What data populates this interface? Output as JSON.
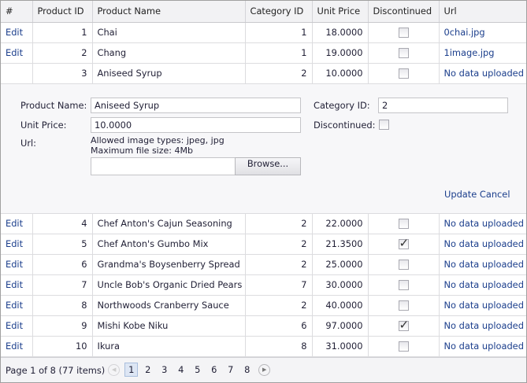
{
  "columns": [
    "#",
    "Product ID",
    "Product Name",
    "Category ID",
    "Unit Price",
    "Discontinued",
    "Url"
  ],
  "edit_label": "Edit",
  "rows_before": [
    {
      "id": "1",
      "name": "Chai",
      "cat": "1",
      "price": "18.0000",
      "disc": false,
      "url": "0chai.jpg"
    },
    {
      "id": "2",
      "name": "Chang",
      "cat": "1",
      "price": "19.0000",
      "disc": false,
      "url": "1image.jpg"
    }
  ],
  "editing_row": {
    "id": "3",
    "name": "Aniseed Syrup",
    "cat": "2",
    "price": "10.0000",
    "disc": false,
    "url": "No data uploaded"
  },
  "edit_form": {
    "product_name_label": "Product Name:",
    "product_name": "Aniseed Syrup",
    "category_label": "Category ID:",
    "category": "2",
    "unit_price_label": "Unit Price:",
    "unit_price": "10.0000",
    "discontinued_label": "Discontinued:",
    "discontinued": false,
    "url_label": "Url:",
    "allowed_types": "Allowed image types: jpeg, jpg",
    "max_size": "Maximum file size: 4Mb",
    "browse_label": "Browse...",
    "update_label": "Update",
    "cancel_label": "Cancel"
  },
  "rows_after": [
    {
      "id": "4",
      "name": "Chef Anton's Cajun Seasoning",
      "cat": "2",
      "price": "22.0000",
      "disc": false,
      "url": "No data uploaded"
    },
    {
      "id": "5",
      "name": "Chef Anton's Gumbo Mix",
      "cat": "2",
      "price": "21.3500",
      "disc": true,
      "url": "No data uploaded"
    },
    {
      "id": "6",
      "name": "Grandma's Boysenberry Spread",
      "cat": "2",
      "price": "25.0000",
      "disc": false,
      "url": "No data uploaded"
    },
    {
      "id": "7",
      "name": "Uncle Bob's Organic Dried Pears",
      "cat": "7",
      "price": "30.0000",
      "disc": false,
      "url": "No data uploaded"
    },
    {
      "id": "8",
      "name": "Northwoods Cranberry Sauce",
      "cat": "2",
      "price": "40.0000",
      "disc": false,
      "url": "No data uploaded"
    },
    {
      "id": "9",
      "name": "Mishi Kobe Niku",
      "cat": "6",
      "price": "97.0000",
      "disc": true,
      "url": "No data uploaded"
    },
    {
      "id": "10",
      "name": "Ikura",
      "cat": "8",
      "price": "31.0000",
      "disc": false,
      "url": "No data uploaded"
    }
  ],
  "pager": {
    "summary": "Page 1 of 8 (77 items)",
    "pages": [
      "1",
      "2",
      "3",
      "4",
      "5",
      "6",
      "7",
      "8"
    ],
    "current": "1"
  }
}
